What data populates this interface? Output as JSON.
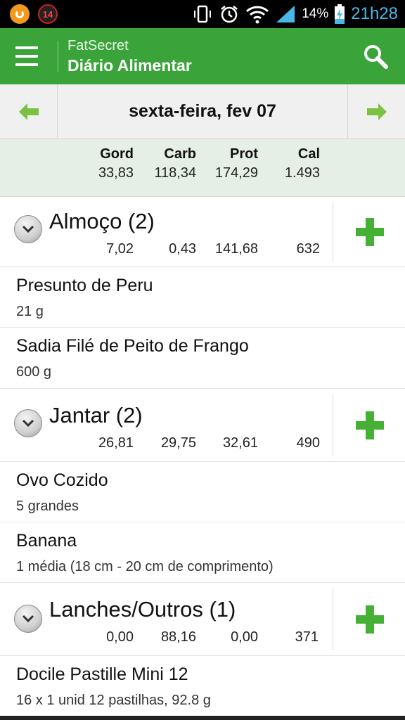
{
  "status_bar": {
    "notification_count": "14",
    "battery_percent": "14%",
    "time": "21h28"
  },
  "app_bar": {
    "app_name": "FatSecret",
    "title": "Diário Alimentar"
  },
  "date_nav": {
    "date": "sexta-feira, fev 07"
  },
  "totals": {
    "headers": [
      "Gord",
      "Carb",
      "Prot",
      "Cal"
    ],
    "values": [
      "33,83",
      "118,34",
      "174,29",
      "1.493"
    ]
  },
  "meals": [
    {
      "name": "Almoço (2)",
      "values": [
        "7,02",
        "0,43",
        "141,68",
        "632"
      ],
      "items": [
        {
          "name": "Presunto de Peru",
          "qty": "21 g"
        },
        {
          "name": "Sadia Filé de Peito de Frango",
          "qty": "600 g"
        }
      ]
    },
    {
      "name": "Jantar (2)",
      "values": [
        "26,81",
        "29,75",
        "32,61",
        "490"
      ],
      "items": [
        {
          "name": "Ovo Cozido",
          "qty": "5 grandes"
        },
        {
          "name": "Banana",
          "qty": "1 média (18 cm - 20 cm de comprimento)"
        }
      ]
    },
    {
      "name": "Lanches/Outros (1)",
      "values": [
        "0,00",
        "88,16",
        "0,00",
        "371"
      ],
      "items": [
        {
          "name": "Docile Pastille Mini 12",
          "qty": "16  x 1 unid 12 pastilhas, 92.8 g"
        }
      ]
    }
  ],
  "colors": {
    "app_bar": "#3aa43a",
    "accent_green": "#44b034",
    "totals_bg": "#e6efe6",
    "time_blue": "#49b8e8"
  },
  "icons": {
    "menu": "hamburger-menu-icon",
    "search": "search-icon",
    "prev": "arrow-left-icon",
    "next": "arrow-right-icon",
    "expand": "chevron-down-icon",
    "add": "plus-icon"
  }
}
